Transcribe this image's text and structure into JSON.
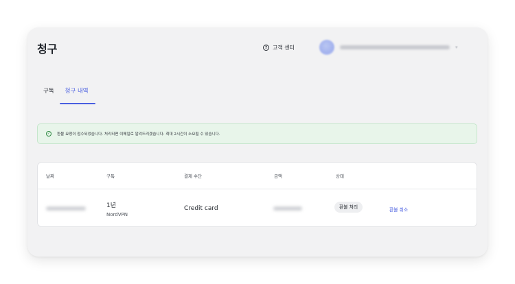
{
  "header": {
    "title": "청구",
    "support_label": "고객 센터",
    "help_icon": "question-circle-icon",
    "account_icon": "avatar"
  },
  "tabs": [
    {
      "label": "구독",
      "active": false
    },
    {
      "label": "청구 내역",
      "active": true
    }
  ],
  "notice": {
    "icon": "check-circle-icon",
    "text": "환불 요청이 접수되었습니다. 처리되면 이메일로 알려드리겠습니다. 최대 2시간이 소요될 수 있습니다."
  },
  "table": {
    "columns": [
      "날짜",
      "구독",
      "결제 수단",
      "금액",
      "상태"
    ],
    "rows": [
      {
        "plan_duration": "1년",
        "plan_name": "NordVPN",
        "payment_method": "Credit card",
        "status": "환불 처리",
        "action": "환불 취소"
      }
    ]
  },
  "colors": {
    "accent": "#4a5fe0",
    "notice_bg": "#e8f5ea",
    "success": "#2f8a43",
    "panel_bg": "#f2f2f3"
  }
}
